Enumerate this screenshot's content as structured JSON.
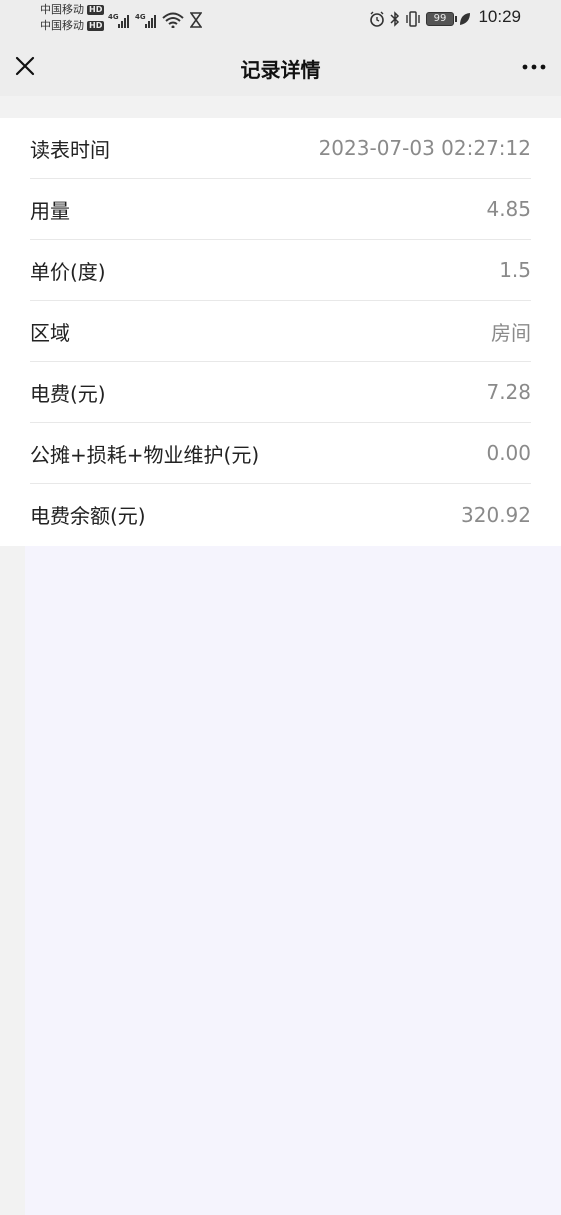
{
  "status_bar": {
    "carrier_1": "中国移动",
    "carrier_2": "中国移动",
    "hd_label": "HD",
    "network_1": "4G",
    "network_2": "4G",
    "battery": "99",
    "time": "10:29",
    "icons": [
      "signal-icon",
      "wifi-icon",
      "hourglass-icon",
      "alarm-icon",
      "bluetooth-icon",
      "vibrate-icon",
      "battery-icon",
      "leaf-icon"
    ]
  },
  "nav": {
    "title": "记录详情",
    "close_icon": "close-icon",
    "more_icon": "more-icon"
  },
  "details": [
    {
      "label": "读表时间",
      "value": "2023-07-03 02:27:12"
    },
    {
      "label": "用量",
      "value": "4.85"
    },
    {
      "label": "单价(度)",
      "value": "1.5"
    },
    {
      "label": "区域",
      "value": "房间"
    },
    {
      "label": "电费(元)",
      "value": "7.28"
    },
    {
      "label": "公摊+损耗+物业维护(元)",
      "value": "0.00"
    },
    {
      "label": "电费余额(元)",
      "value": "320.92"
    }
  ],
  "colors": {
    "page_bg": "#f2f2f2",
    "bar_bg": "#ededed",
    "card_bg": "#ffffff",
    "label_text": "#222222",
    "value_text": "#8a8a8a",
    "lower_bg": "#f5f4fd"
  }
}
